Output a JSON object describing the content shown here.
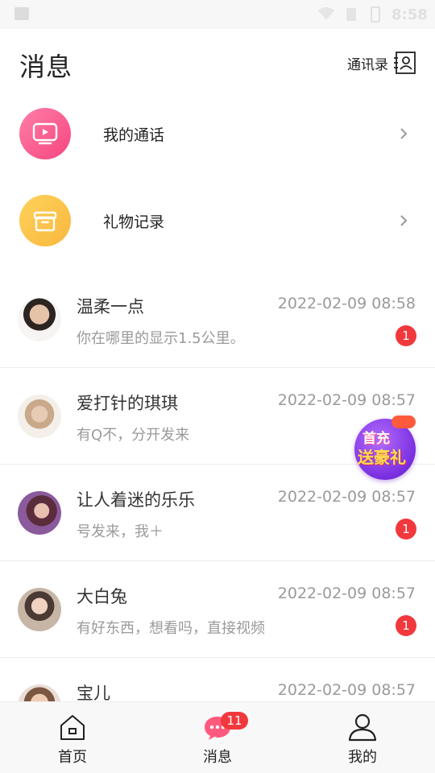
{
  "status_bar": {
    "time": "8:58",
    "icons": [
      "image-icon",
      "wifi-icon",
      "sim-icon",
      "battery-icon"
    ]
  },
  "header": {
    "title": "消息",
    "contacts_label": "通讯录",
    "contacts_icon": "contact-card-icon"
  },
  "features": [
    {
      "label": "我的通话",
      "icon": "video-call-icon",
      "color": "#f6457f"
    },
    {
      "label": "礼物记录",
      "icon": "gift-icon",
      "color": "#f8b83f"
    }
  ],
  "conversations": [
    {
      "name": "温柔一点",
      "time": "2022-02-09 08:58",
      "preview": "你在哪里的显示1.5公里。",
      "unread": "1"
    },
    {
      "name": "爱打针的琪琪",
      "time": "2022-02-09 08:57",
      "preview": "有Q不，分开发来",
      "unread": ""
    },
    {
      "name": "让人着迷的乐乐",
      "time": "2022-02-09 08:57",
      "preview": "号发来，我＋",
      "unread": "1"
    },
    {
      "name": "大白兔",
      "time": "2022-02-09 08:57",
      "preview": "有好东西，想看吗，直接视频",
      "unread": "1"
    },
    {
      "name": "宝儿",
      "time": "2022-02-09 08:57",
      "preview": "",
      "unread": ""
    }
  ],
  "promo": {
    "line1": "首充",
    "line2": "送豪礼"
  },
  "tab_bar": {
    "home_label": "首页",
    "messages_label": "消息",
    "messages_badge": "11",
    "me_label": "我的"
  },
  "colors": {
    "badge_red": "#f1383d",
    "call_pink": "#f6457f",
    "gift_yellow": "#f8b83f",
    "secondary_text": "#9a9a9a"
  }
}
